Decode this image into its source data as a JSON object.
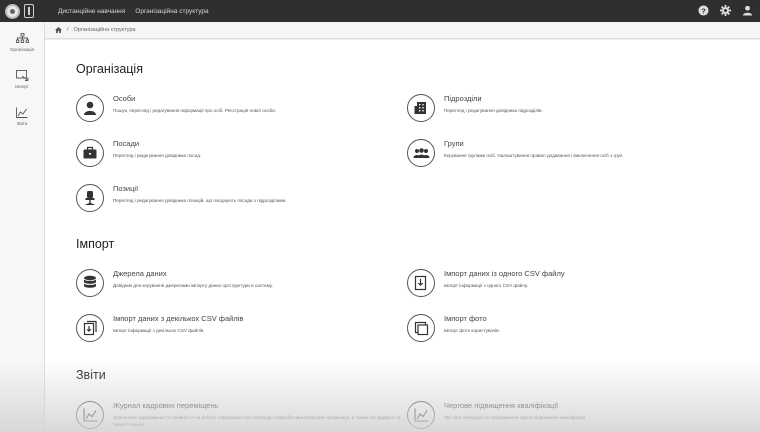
{
  "topbar": {
    "nav": [
      {
        "label": "Дистанційне навчання"
      },
      {
        "label": "Організаційна структура"
      }
    ],
    "icons": [
      "help-icon",
      "gear-icon",
      "user-icon"
    ]
  },
  "sidebar": {
    "items": [
      {
        "label": "Організація",
        "icon": "org-tree-icon"
      },
      {
        "label": "Імпорт",
        "icon": "import-icon"
      },
      {
        "label": "Звіти",
        "icon": "chart-icon"
      }
    ]
  },
  "breadcrumb": {
    "home_icon": "home-icon",
    "current": "Організаційна структура"
  },
  "sections": {
    "organization": {
      "title": "Організація",
      "items": [
        {
          "title": "Особи",
          "desc": "Пошук, перегляд і редагування інформації про осіб. Реєстрація нової особи.",
          "icon": "person-icon"
        },
        {
          "title": "Підрозділи",
          "desc": "Перегляд і редагування довідника підрозділів.",
          "icon": "building-icon"
        },
        {
          "title": "Посади",
          "desc": "Перегляд і редагування довідника посад.",
          "icon": "briefcase-icon"
        },
        {
          "title": "Групи",
          "desc": "Керування групами осіб. Налаштування правил додавання і виключення осіб з груп.",
          "icon": "group-icon"
        },
        {
          "title": "Позиції",
          "desc": "Перегляд і редагування довідника позицій, що поєднують посади з підрозділами.",
          "icon": "chair-icon"
        }
      ]
    },
    "import": {
      "title": "Імпорт",
      "items": [
        {
          "title": "Джерела даних",
          "desc": "Довідник для керування джерелами імпорту даних оргструктури в систему.",
          "icon": "database-icon"
        },
        {
          "title": "Імпорт даних із одного CSV файлу",
          "desc": "Імпорт інформації з одного CSV файлу.",
          "icon": "file-import-icon"
        },
        {
          "title": "Імпорт даних з декількох CSV файлів",
          "desc": "Імпорт інформації з декількох CSV файлів.",
          "icon": "files-import-icon"
        },
        {
          "title": "Імпорт фото",
          "desc": "Імпорт фото користувачів.",
          "icon": "photo-import-icon"
        }
      ]
    },
    "reports": {
      "title": "Звіти",
      "items": [
        {
          "title": "Журнал кадрових переміщень",
          "desc": "Хронологія зарахування та прийняття на роботу. Інформація про переходи співробітника всередині організації, а також про відкриті та закриті позиції.",
          "icon": "chart-icon"
        },
        {
          "title": "Чергове підвищення кваліфікації",
          "desc": "Звіт про необхідність проходження курсів підвищення кваліфікації",
          "icon": "chart-icon"
        }
      ]
    }
  }
}
